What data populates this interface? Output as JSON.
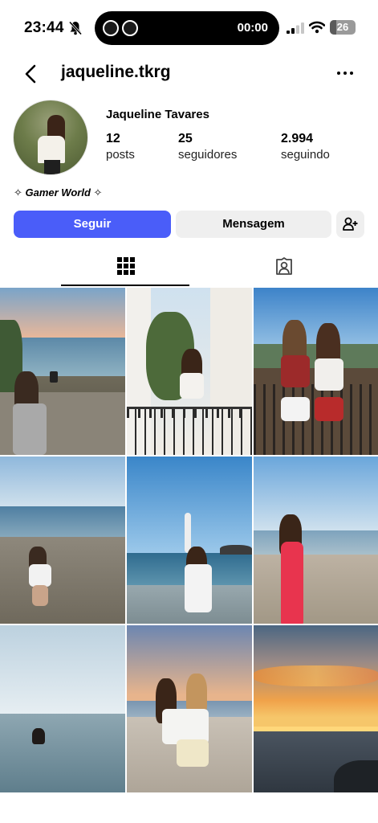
{
  "status_bar": {
    "time": "23:44",
    "island_time": "00:00",
    "battery": "26",
    "battery_level": 0.26
  },
  "header": {
    "username": "jaqueline.tkrg"
  },
  "profile": {
    "display_name": "Jaqueline Tavares",
    "stats": [
      {
        "value": "12",
        "label": "posts"
      },
      {
        "value": "25",
        "label": "seguidores"
      },
      {
        "value": "2.994",
        "label": "seguindo"
      }
    ],
    "bio": "✧ Gamer World ✧"
  },
  "actions": {
    "follow_label": "Seguir",
    "message_label": "Mensagem"
  },
  "icons": {
    "back": "chevron-left-icon",
    "more": "more-horizontal-icon",
    "add_user": "add-user-icon",
    "grid_tab": "grid-icon",
    "tagged_tab": "tagged-person-icon"
  },
  "colors": {
    "follow_button": "#4a5df9",
    "secondary_button": "#efefef"
  },
  "posts": [
    {
      "subject": "girl photographing coastline"
    },
    {
      "subject": "girl on balcony with palm"
    },
    {
      "subject": "two girls on balcony"
    },
    {
      "subject": "girl sitting on beach"
    },
    {
      "subject": "girl with arm raised at beach"
    },
    {
      "subject": "girl in red dress on beach"
    },
    {
      "subject": "girl swimming in sea"
    },
    {
      "subject": "two girls hugging at sunset"
    },
    {
      "subject": "sunset over sea"
    }
  ]
}
